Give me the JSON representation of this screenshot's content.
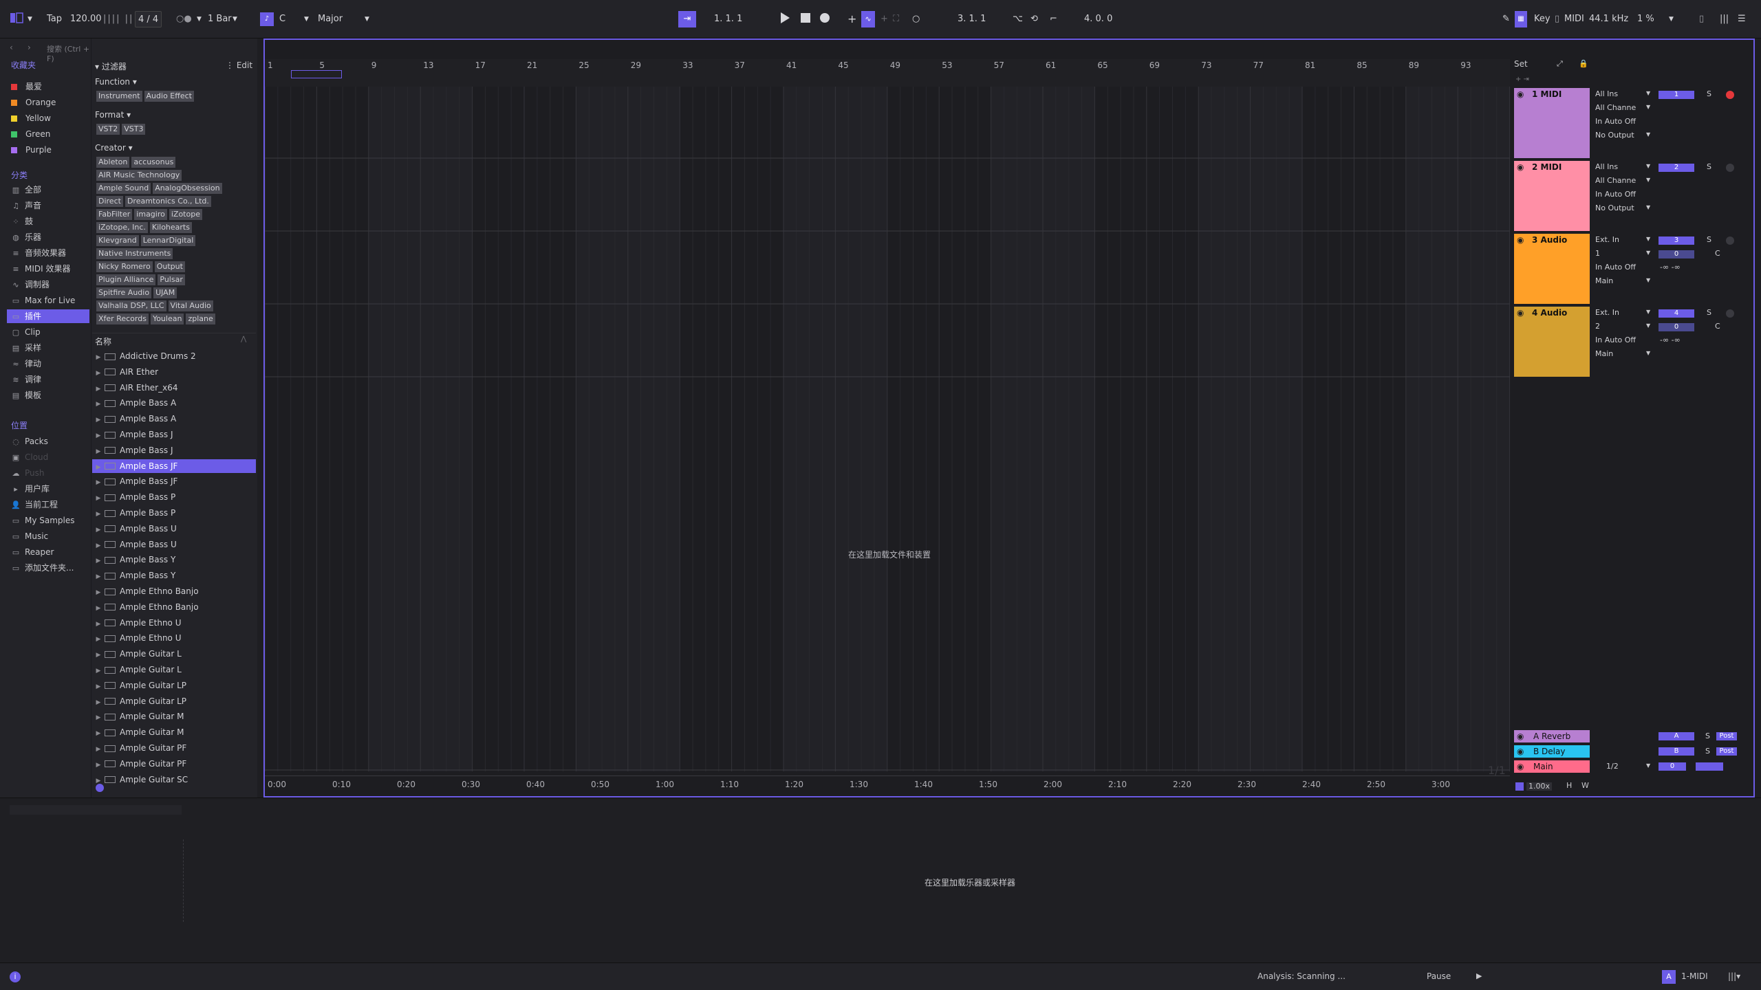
{
  "toolbar": {
    "tap": "Tap",
    "tempo": "120.00",
    "time_sig": "4 / 4",
    "quantize": "1 Bar",
    "key_root": "C",
    "scale": "Major",
    "position": "1.   1.   1",
    "loop_start": "3.   1.   1",
    "loop_length": "4.   0.   0",
    "key_label": "Key",
    "midi_label": "MIDI",
    "sample_rate": "44.1 kHz",
    "cpu": "1 %"
  },
  "sidebar": {
    "search_placeholder": "搜索 (Ctrl + F)",
    "favorites_header": "收藏夹",
    "favorites": [
      {
        "label": "最爱",
        "color": "#e5383b"
      },
      {
        "label": "Orange",
        "color": "#f08a24"
      },
      {
        "label": "Yellow",
        "color": "#f0d02c"
      },
      {
        "label": "Green",
        "color": "#3fc46a"
      },
      {
        "label": "Purple",
        "color": "#a66ef0"
      }
    ],
    "categories_header": "分类",
    "categories": [
      "全部",
      "声音",
      "鼓",
      "乐器",
      "音频效果器",
      "MIDI 效果器",
      "调制器",
      "Max for Live",
      "插件",
      "Clip",
      "采样",
      "律动",
      "调律",
      "模板"
    ],
    "places_header": "位置",
    "places": [
      "Packs",
      "Cloud",
      "Push",
      "用户库",
      "当前工程",
      "My Samples",
      "Music",
      "Reaper",
      "添加文件夹..."
    ]
  },
  "browser": {
    "filter_label": "过滤器",
    "edit_label": "Edit",
    "function_label": "Function",
    "function_tags": [
      "Instrument",
      "Audio Effect"
    ],
    "format_label": "Format",
    "format_tags": [
      "VST2",
      "VST3"
    ],
    "creator_label": "Creator",
    "creator_tags": [
      [
        "Ableton",
        "accusonus"
      ],
      [
        "AIR Music Technology"
      ],
      [
        "Ample Sound",
        "AnalogObsession"
      ],
      [
        "Direct",
        "Dreamtonics Co., Ltd."
      ],
      [
        "FabFilter",
        "imagiro",
        "iZotope"
      ],
      [
        "iZotope, Inc.",
        "Kilohearts"
      ],
      [
        "Klevgrand",
        "LennarDigital"
      ],
      [
        "Native Instruments"
      ],
      [
        "Nicky Romero",
        "Output"
      ],
      [
        "Plugin Alliance",
        "Pulsar"
      ],
      [
        "Spitfire Audio",
        "UJAM"
      ],
      [
        "Valhalla DSP, LLC",
        "Vital Audio"
      ],
      [
        "Xfer Records",
        "Youlean",
        "zplane"
      ]
    ],
    "name_header": "名称",
    "items": [
      "Addictive Drums 2",
      "AIR Ether",
      "AIR Ether_x64",
      "Ample Bass A",
      "Ample Bass A",
      "Ample Bass J",
      "Ample Bass J",
      "Ample Bass JF",
      "Ample Bass JF",
      "Ample Bass P",
      "Ample Bass P",
      "Ample Bass U",
      "Ample Bass U",
      "Ample Bass Y",
      "Ample Bass Y",
      "Ample Ethno Banjo",
      "Ample Ethno Banjo",
      "Ample Ethno U",
      "Ample Ethno U",
      "Ample Guitar L",
      "Ample Guitar L",
      "Ample Guitar LP",
      "Ample Guitar LP",
      "Ample Guitar M",
      "Ample Guitar M",
      "Ample Guitar PF",
      "Ample Guitar PF",
      "Ample Guitar SC"
    ]
  },
  "arrangement": {
    "bar_numbers": [
      "1",
      "5",
      "9",
      "13",
      "17",
      "21",
      "25",
      "29",
      "33",
      "37",
      "41",
      "45",
      "49",
      "53",
      "57",
      "61",
      "65",
      "69",
      "73",
      "77",
      "81",
      "85",
      "89",
      "93"
    ],
    "set_label": "Set",
    "drop_hint": "在这里加载文件和装置",
    "time_labels": [
      "0:00",
      "0:10",
      "0:20",
      "0:30",
      "0:40",
      "0:50",
      "1:00",
      "1:10",
      "1:20",
      "1:30",
      "1:40",
      "1:50",
      "2:00",
      "2:10",
      "2:20",
      "2:30",
      "2:40",
      "2:50",
      "3:00"
    ],
    "zoom_page": "1/1",
    "zoom": "1.00x",
    "h_label": "H",
    "w_label": "W"
  },
  "tracks": [
    {
      "name": "1 MIDI",
      "color": "#b77fd1",
      "io": [
        "All Ins",
        "All Channe",
        "In  Auto  Off",
        "No Output"
      ],
      "num": "1",
      "s": "S"
    },
    {
      "name": "2 MIDI",
      "color": "#ff8fa6",
      "io": [
        "All Ins",
        "All Channe",
        "In  Auto  Off",
        "No Output"
      ],
      "num": "2",
      "s": "S"
    },
    {
      "name": "3 Audio",
      "color": "#ffa028",
      "io": [
        "Ext. In",
        "1",
        "In  Auto  Off",
        "Main"
      ],
      "num": "3",
      "s": "S",
      "vol": "0",
      "pan": "C",
      "db": "-∞   -∞"
    },
    {
      "name": "4 Audio",
      "color": "#d4a030",
      "io": [
        "Ext. In",
        "2",
        "In  Auto  Off",
        "Main"
      ],
      "num": "4",
      "s": "S",
      "vol": "0",
      "pan": "C",
      "db": "-∞   -∞"
    }
  ],
  "returns": [
    {
      "name": "A Reverb",
      "color": "#b77fd1",
      "num": "A",
      "s": "S",
      "post": "Post"
    },
    {
      "name": "B Delay",
      "color": "#29c4f0",
      "num": "B",
      "s": "S",
      "post": "Post"
    },
    {
      "name": "Main",
      "color": "#ff6b8a",
      "out": "1/2",
      "vol": "0"
    }
  ],
  "detail": {
    "drop_hint": "在这里加载乐器或采样器"
  },
  "status": {
    "analysis": "Analysis: Scanning ...",
    "pause": "Pause",
    "track": "1-MIDI",
    "track_badge": "A"
  }
}
